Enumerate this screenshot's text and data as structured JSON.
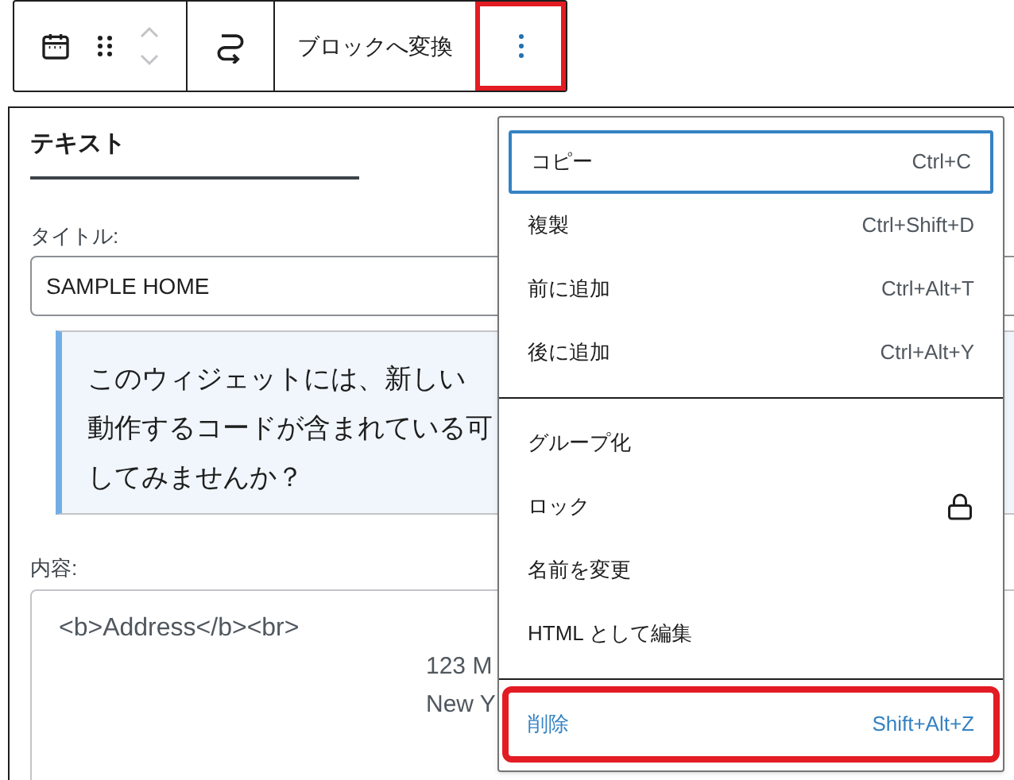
{
  "toolbar": {
    "convert_label": "ブロックへ変換",
    "options_highlighted": true
  },
  "panel": {
    "tab": {
      "label": "テキスト",
      "selected": true
    },
    "title_label": "タイトル:",
    "title_value": "SAMPLE HOME",
    "notice_lines": [
      "このウィジェットには、新しい",
      "動作するコードが含まれている可",
      "してみませんか？"
    ],
    "content_label": "内容:",
    "content_lines": [
      {
        "text": "<b>Address</b><br>",
        "indent": false
      },
      {
        "text": "123 M",
        "indent": true
      },
      {
        "text": "New Y",
        "indent": true
      }
    ]
  },
  "menu": {
    "groups": [
      [
        {
          "label": "コピー",
          "shortcut": "Ctrl+C",
          "focused": true,
          "highlighted": false,
          "danger": false
        },
        {
          "label": "複製",
          "shortcut": "Ctrl+Shift+D",
          "focused": false,
          "highlighted": false,
          "danger": false
        },
        {
          "label": "前に追加",
          "shortcut": "Ctrl+Alt+T",
          "focused": false,
          "highlighted": false,
          "danger": false
        },
        {
          "label": "後に追加",
          "shortcut": "Ctrl+Alt+Y",
          "focused": false,
          "highlighted": false,
          "danger": false
        }
      ],
      [
        {
          "label": "グループ化",
          "focused": false,
          "highlighted": false,
          "danger": false
        },
        {
          "label": "ロック",
          "kind": "lock",
          "focused": false,
          "highlighted": false,
          "danger": false
        },
        {
          "label": "名前を変更",
          "focused": false,
          "highlighted": false,
          "danger": false
        },
        {
          "label": "HTML として編集",
          "focused": false,
          "highlighted": false,
          "danger": false
        }
      ],
      [
        {
          "label": "削除",
          "shortcut": "Shift+Alt+Z",
          "focused": false,
          "highlighted": true,
          "danger": true
        }
      ]
    ]
  }
}
